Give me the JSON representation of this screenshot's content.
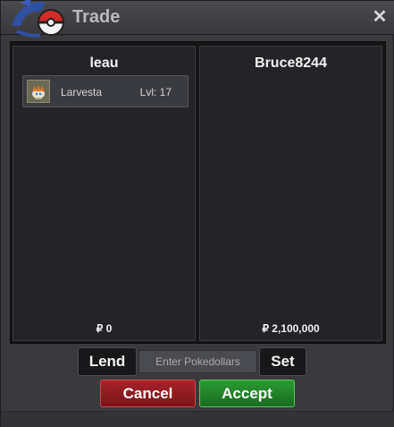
{
  "window": {
    "title": "Trade",
    "close_icon": "close-icon"
  },
  "left_panel": {
    "player": "leau",
    "items": [
      {
        "name": "Larvesta",
        "level": "Lvl: 17",
        "icon": "larvesta-icon"
      }
    ],
    "money": "₽ 0"
  },
  "right_panel": {
    "player": "Bruce8244",
    "items": [],
    "money": "₽ 2,100,000"
  },
  "controls": {
    "lend_label": "Lend",
    "pokedollars_placeholder": "Enter Pokedollars",
    "set_label": "Set",
    "cancel_label": "Cancel",
    "accept_label": "Accept"
  },
  "colors": {
    "cancel": "#9a1f25",
    "accept": "#24892a",
    "panel": "#242428"
  }
}
